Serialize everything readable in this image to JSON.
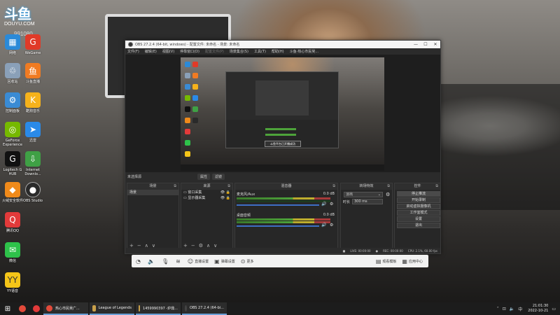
{
  "desktop": {
    "logo_text": "斗鱼",
    "logo_sub": "DOUYU.COM",
    "watermark": "991080",
    "icons": [
      {
        "label": "网络",
        "icon": "network-icon",
        "color": "#2b8ad8"
      },
      {
        "label": "WeGame",
        "icon": "wegame-icon",
        "color": "#e03a28"
      },
      {
        "label": "回收站",
        "icon": "recycle-bin-icon",
        "color": "#8aa0b8"
      },
      {
        "label": "斗鱼直播",
        "icon": "douyu-live-icon",
        "color": "#f07b22"
      },
      {
        "label": "控制面板",
        "icon": "control-panel-icon",
        "color": "#3a8bd4"
      },
      {
        "label": "酷狗音乐",
        "icon": "kugou-music-icon",
        "color": "#f6b21b"
      },
      {
        "label": "GeForce Experience",
        "icon": "geforce-icon",
        "color": "#76b900"
      },
      {
        "label": "迅雷",
        "icon": "xunlei-icon",
        "color": "#2a8ae8"
      },
      {
        "label": "Logitech G HUB",
        "icon": "logitech-icon",
        "color": "#111111"
      },
      {
        "label": "Internet Downlo...",
        "icon": "idm-icon",
        "color": "#3fa045"
      },
      {
        "label": "火绒安全软件",
        "icon": "huorong-icon",
        "color": "#f08a1a"
      },
      {
        "label": "OBS Studio",
        "icon": "obs-icon",
        "color": "#2a2a2a"
      },
      {
        "label": "腾讯QQ",
        "icon": "qq-icon",
        "color": "#e23a3a"
      },
      {
        "label": "微信",
        "icon": "wechat-icon",
        "color": "#2ec24a"
      },
      {
        "label": "YY语音",
        "icon": "yy-icon",
        "color": "#f5c518"
      }
    ]
  },
  "obs": {
    "title": "OBS 27.2.4 (64-bit, windows) - 配置文件: 未命名 - 场景: 未命名",
    "menu": [
      "文件(F)",
      "编辑(E)",
      "视图(V)",
      "停靠窗口(D)",
      "配置文件(P)",
      "场景集合(S)",
      "工具(T)",
      "帮助(H)",
      "斗鱼-热心市民吴...",
      "斗鱼直播"
    ],
    "preview_toast": "斗鱼平台已开播成功",
    "toolbar_label": "未选择源",
    "strip_buttons": [
      "属性",
      "滤镜"
    ],
    "scenes": {
      "title": "场景",
      "items": [
        "场景"
      ]
    },
    "sources": {
      "title": "来源",
      "items": [
        "窗口采集",
        "显示器采集"
      ]
    },
    "mixer": {
      "title": "混音器",
      "channels": [
        {
          "name": "麦克风/Aux",
          "db": "0.0 dB"
        },
        {
          "name": "桌面音频",
          "db": "0.0 dB"
        }
      ]
    },
    "transitions": {
      "title": "转场特效",
      "selected": "淡出",
      "duration_label": "时长",
      "duration": "300 ms"
    },
    "controls": {
      "title": "控件",
      "buttons": [
        "停止推流",
        "开始录制",
        "启动虚拟摄像机",
        "工作室模式",
        "设置",
        "退出"
      ]
    },
    "status": {
      "live": "LIVE: 00:00:00",
      "rec": "REC: 00:00:00",
      "cpu": "CPU: 2.1%, 60.00 fps"
    },
    "foot_symbols": [
      "+",
      "−",
      "∧",
      "∨"
    ],
    "foot_symbols_src": [
      "+",
      "−",
      "⚙",
      "∧",
      "∨"
    ]
  },
  "live_toolbar": {
    "items": [
      "直播设置",
      "弹幕设置",
      "更多"
    ],
    "right_items": [
      "观看模板",
      "应用中心"
    ]
  },
  "taskbar": {
    "tasks": [
      {
        "label": "热心市民吴广...",
        "color": "#e24a3a"
      },
      {
        "label": "League of Legends",
        "color": "#c9a04a"
      },
      {
        "label": "1459990397 -炉鼎...",
        "color": "#c9a04a"
      },
      {
        "label": "OBS 27.2.4 (64-bi...",
        "color": "#444444"
      }
    ],
    "time": "21:01:30",
    "date": "2022-10-21"
  }
}
